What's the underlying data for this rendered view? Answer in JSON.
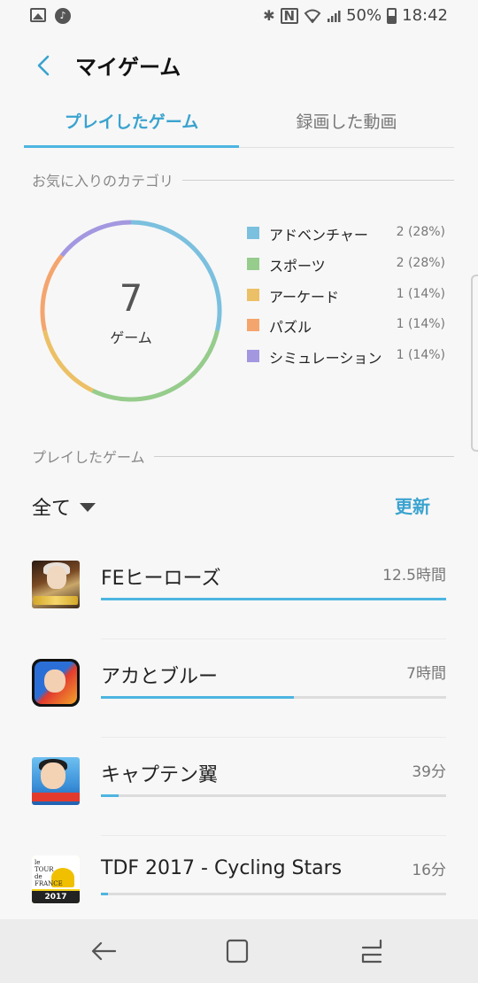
{
  "status_bar": {
    "battery": "50%",
    "time": "18:42",
    "icons": [
      "image-icon",
      "music-icon",
      "bluetooth-icon",
      "nfc-icon",
      "wifi-icon",
      "signal-icon",
      "battery-icon"
    ]
  },
  "header": {
    "title": "マイゲーム"
  },
  "tabs": [
    {
      "label": "プレイしたゲーム",
      "active": true
    },
    {
      "label": "録画した動画",
      "active": false
    }
  ],
  "favorites": {
    "section_title": "お気に入りのカテゴリ",
    "total": "7",
    "total_label": "ゲーム",
    "categories": [
      {
        "name": "アドベンチャー",
        "value": "2 (28%)",
        "share": 2,
        "color": "#7bc0de"
      },
      {
        "name": "スポーツ",
        "value": "2 (28%)",
        "share": 2,
        "color": "#96cc8c"
      },
      {
        "name": "アーケード",
        "value": "1 (14%)",
        "share": 1,
        "color": "#ecc066"
      },
      {
        "name": "パズル",
        "value": "1 (14%)",
        "share": 1,
        "color": "#f4a56e"
      },
      {
        "name": "シミュレーション",
        "value": "1 (14%)",
        "share": 1,
        "color": "#a398e0"
      }
    ]
  },
  "played": {
    "section_title": "プレイしたゲーム",
    "filter": "全て",
    "refresh_label": "更新",
    "games": [
      {
        "name": "FEヒーローズ",
        "time": "12.5時間",
        "progress": 1.0
      },
      {
        "name": "アカとブルー",
        "time": "7時間",
        "progress": 0.56
      },
      {
        "name": "キャプテン翼",
        "time": "39分",
        "progress": 0.05
      },
      {
        "name": "TDF 2017 - Cycling Stars",
        "time": "16分",
        "progress": 0.02,
        "icon_text_top": "le TOUR de FRANCE",
        "icon_text_bottom": "2017 GAME"
      }
    ]
  },
  "accent_color": "#4db5e0"
}
